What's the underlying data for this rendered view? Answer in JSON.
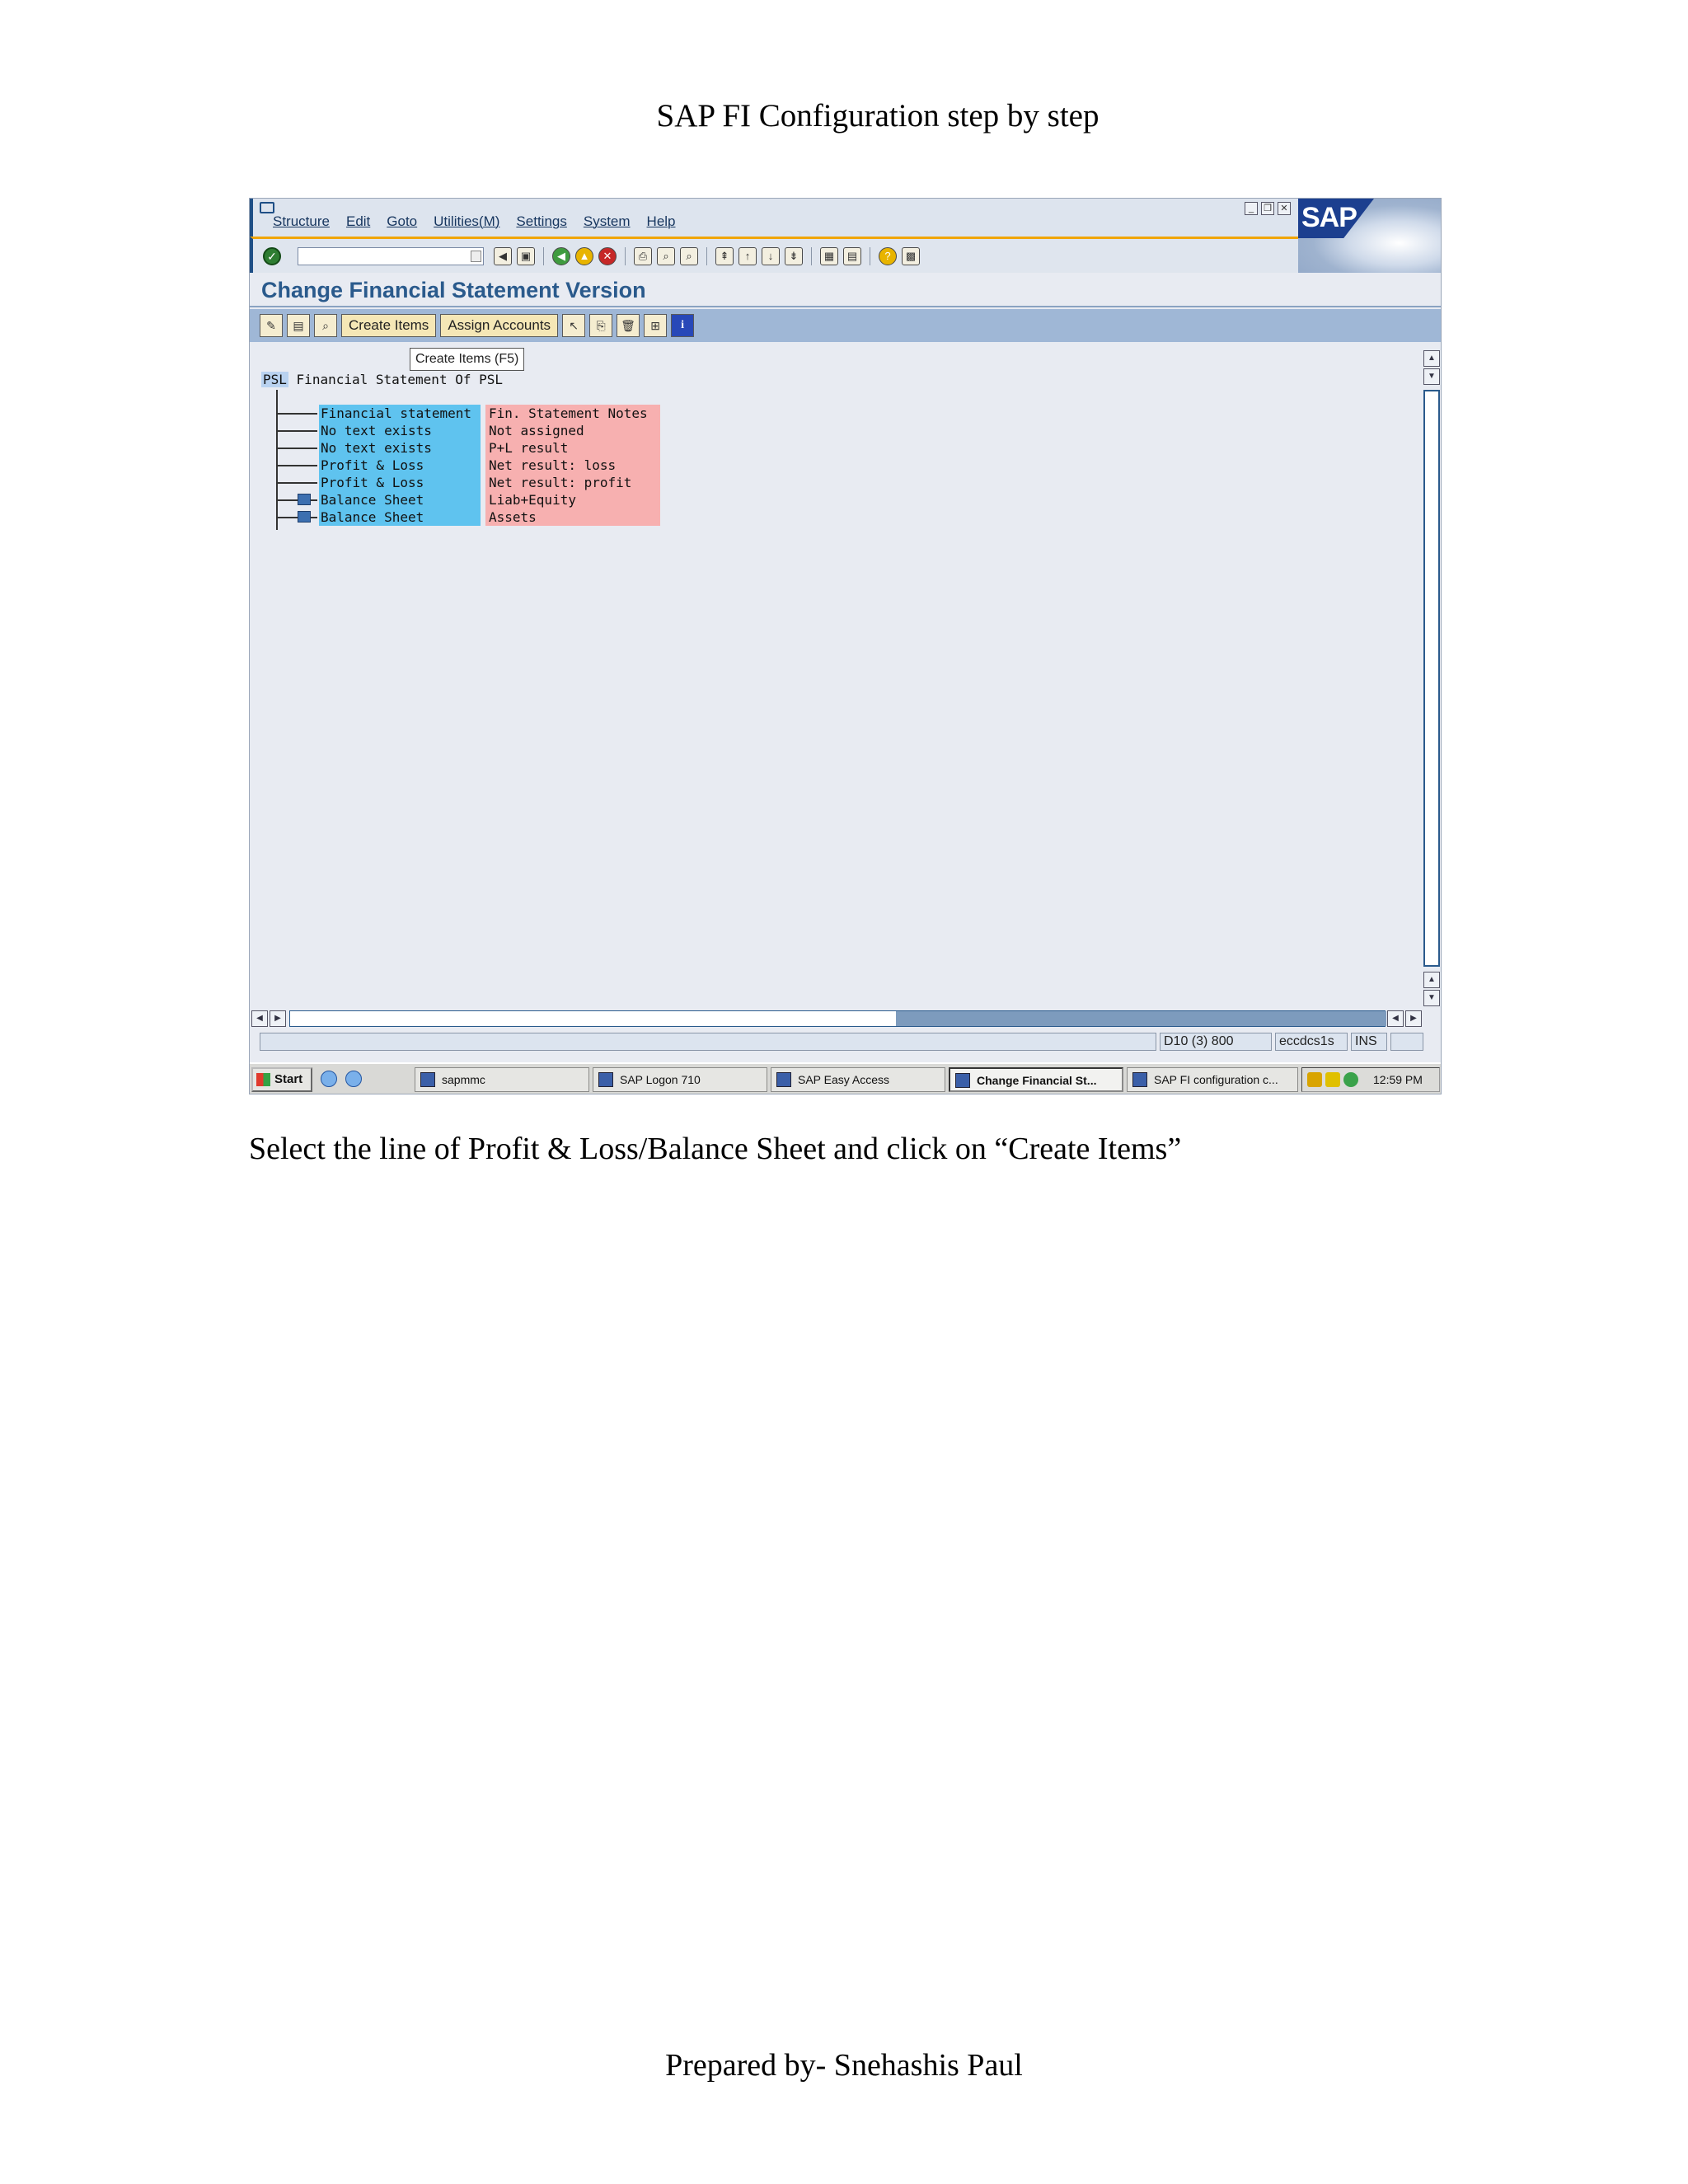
{
  "document": {
    "header": "SAP FI Configuration step by step",
    "caption": "Select the line of Profit & Loss/Balance Sheet and click on “Create Items”",
    "footer": "Prepared by- Snehashis Paul"
  },
  "sap_window": {
    "logo_text": "SAP",
    "menu": [
      "Structure",
      "Edit",
      "Goto",
      "Utilities(M)",
      "Settings",
      "System",
      "Help"
    ],
    "screen_title": "Change Financial Statement Version",
    "app_toolbar": {
      "create_items": "Create Items",
      "assign_accounts": "Assign Accounts"
    },
    "tooltip": "Create Items   (F5)",
    "tree": {
      "root_key": "PSL",
      "root_text": "Financial Statement Of PSL",
      "nodes": [
        {
          "text": "Financial statement",
          "value": "Fin. Statement Notes",
          "folder": false
        },
        {
          "text": "No text exists",
          "value": "Not assigned",
          "folder": false
        },
        {
          "text": "No text exists",
          "value": "P+L result",
          "folder": false
        },
        {
          "text": "Profit & Loss",
          "value": "Net result: loss",
          "folder": false
        },
        {
          "text": "Profit & Loss",
          "value": "Net result: profit",
          "folder": false
        },
        {
          "text": "Balance Sheet",
          "value": "Liab+Equity",
          "folder": true
        },
        {
          "text": "Balance Sheet",
          "value": "Assets",
          "folder": true
        }
      ]
    },
    "status": {
      "system": "D10 (3) 800",
      "server": "eccdcs1s",
      "mode": "INS"
    }
  },
  "taskbar": {
    "start": "Start",
    "tasks": [
      "sapmmc",
      "SAP Logon 710",
      "SAP Easy Access",
      "Change Financial St...",
      "SAP FI configuration c..."
    ],
    "clock": "12:59 PM"
  },
  "colors": {
    "title_blue": "#2a5a8c",
    "tree_text_bg": "#5fc3ef",
    "tree_value_bg": "#f7b0b0",
    "app_toolbar_bg": "#9fb7d6"
  }
}
